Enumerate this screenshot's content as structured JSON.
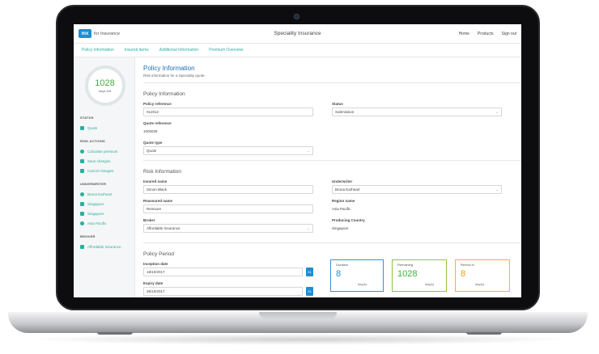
{
  "app": {
    "logo": "mx",
    "logo_text": "for Insurance",
    "title": "Speciality Insurance"
  },
  "topnav": [
    "Home",
    "Products",
    "Sign out"
  ],
  "tabs": [
    "Policy Information",
    "Insured items",
    "Additional Information",
    "Premium Overview"
  ],
  "sidebar": {
    "days_left": "1028",
    "days_left_label": "days left",
    "status_header": "STATUS",
    "status_item": "Quote",
    "risk_header": "RISK ACTIONS",
    "risk_items": [
      "Calculate premium",
      "Save changes",
      "Cancel changes"
    ],
    "underwriter_header": "UNDERWRITER",
    "underwriter_items": [
      "Bruna Earheart",
      "Singapore",
      "Singapore",
      "Asia Pacific"
    ],
    "broker_header": "BROKER",
    "broker_item": "Affordable Insurance"
  },
  "main": {
    "title": "Policy Information",
    "subtitle": "Risk information for a Speciality quote.",
    "policy_info_header": "Policy Information",
    "policy_reference_label": "Policy reference",
    "policy_reference": "012012",
    "status_label": "Status",
    "status": "Submission",
    "quote_reference_label": "Quote reference",
    "quote_reference": "1000028",
    "quote_type_label": "Quote type",
    "quote_type": "Quote",
    "risk_info_header": "Risk Information",
    "insured_name_label": "Insured name",
    "insured_name": "Simon Black",
    "underwriter_label": "Underwriter",
    "underwriter": "Bruna Earheart",
    "reassured_name_label": "Reassured name",
    "reassured_name": "Reinsure",
    "region_name_label": "Region name",
    "region_name": "Asia Pacific",
    "broker_label": "Broker",
    "broker": "Affordable Insurance",
    "producing_country_label": "Producing Country",
    "producing_country": "Singapore",
    "period_header": "Policy Period",
    "inception_label": "Inception date",
    "inception": "18/10/2017",
    "expiry_label": "Expiry date",
    "expiry": "26/10/2017",
    "date_button": "31"
  },
  "cards": [
    {
      "title": "Duration",
      "value": "8",
      "unit": "day(s)",
      "color": "#1c8fd6",
      "border": "#3b8fd6"
    },
    {
      "title": "Remaining",
      "value": "1028",
      "unit": "day(s)",
      "color": "#3fae3f",
      "border": "#8cc63f"
    },
    {
      "title": "Renew in",
      "value": "8",
      "unit": "day(s)",
      "color": "#f39c12",
      "border": "#f5b041"
    }
  ]
}
